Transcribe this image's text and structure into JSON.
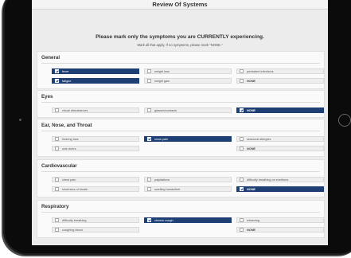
{
  "header": {
    "title": "Review Of Systems"
  },
  "instructions": {
    "main": "Please mark only the symptoms you are CURRENTLY experiencing.",
    "sub": "Mark all that apply. If no symptoms, please mark \"NONE.\""
  },
  "sections": [
    {
      "title": "General",
      "options": [
        {
          "label": "fever",
          "selected": true
        },
        {
          "label": "weight loss",
          "selected": false
        },
        {
          "label": "persistent infections",
          "selected": false
        },
        {
          "label": "fatigue",
          "selected": true
        },
        {
          "label": "weight gain",
          "selected": false
        },
        {
          "label": "NONE",
          "selected": false
        }
      ]
    },
    {
      "title": "Eyes",
      "options": [
        {
          "label": "visual disturbances",
          "selected": false
        },
        {
          "label": "glasses/contacts",
          "selected": false
        },
        {
          "label": "NONE",
          "selected": true
        }
      ]
    },
    {
      "title": "Ear, Nose, and Throat",
      "options": [
        {
          "label": "hearing loss",
          "selected": false
        },
        {
          "label": "sinus pain",
          "selected": true
        },
        {
          "label": "seasonal allergies",
          "selected": false
        },
        {
          "label": "oral ulcers",
          "selected": false
        },
        {
          "label": "NONE",
          "selected": false
        }
      ]
    },
    {
      "title": "Cardiovascular",
      "options": [
        {
          "label": "chest pain",
          "selected": false
        },
        {
          "label": "palpitations",
          "selected": false
        },
        {
          "label": "difficulty breathing on exertions",
          "selected": false
        },
        {
          "label": "shortness of breath",
          "selected": false
        },
        {
          "label": "swelling hands/feet",
          "selected": false
        },
        {
          "label": "NONE",
          "selected": true
        }
      ]
    },
    {
      "title": "Respiratory",
      "options": [
        {
          "label": "difficulty breathing",
          "selected": false
        },
        {
          "label": "chronic cough",
          "selected": true
        },
        {
          "label": "wheezing",
          "selected": false
        },
        {
          "label": "coughing blood",
          "selected": false
        },
        {
          "label": "NONE",
          "selected": false
        }
      ]
    }
  ],
  "colors": {
    "selected": "#1e3f73",
    "panel": "#fafafa",
    "screen": "#ececec"
  }
}
